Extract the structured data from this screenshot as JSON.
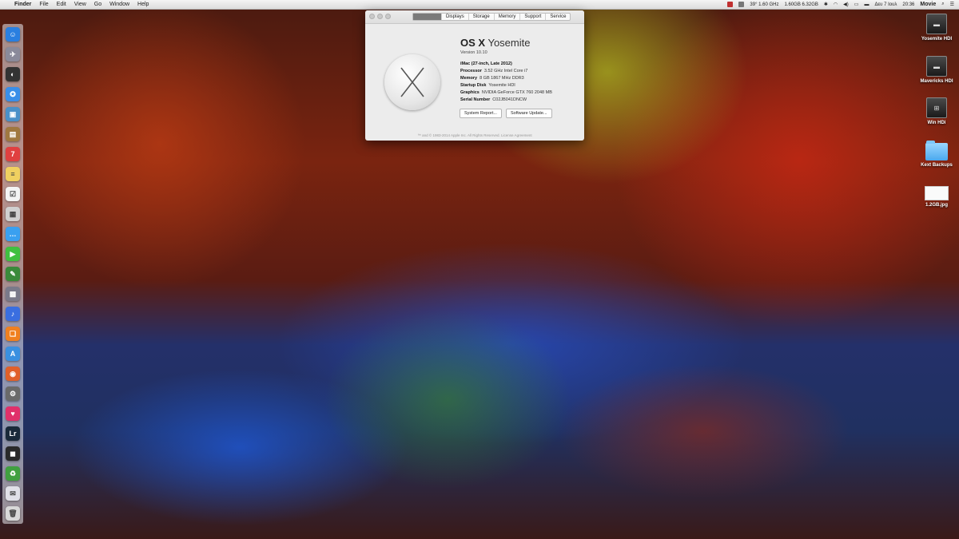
{
  "menubar": {
    "apple_glyph": "",
    "menus": [
      "Finder",
      "File",
      "Edit",
      "View",
      "Go",
      "Window",
      "Help"
    ],
    "status": {
      "temp_cpu": "39° 1.60 GHz",
      "memory": "1.60GB 6.32GB",
      "locale": "Δευ 7 Ιουλ",
      "time": "20:36",
      "app": "Movie"
    }
  },
  "dock": {
    "icons": [
      {
        "name": "finder-icon",
        "glyph": "☺",
        "color": "#2a7fe0"
      },
      {
        "name": "launchpad-icon",
        "glyph": "✈",
        "color": "#8a8a9a"
      },
      {
        "name": "dashboard-icon",
        "glyph": "◐",
        "color": "#333333"
      },
      {
        "name": "safari-icon",
        "glyph": "✪",
        "color": "#3a8ee8"
      },
      {
        "name": "preview-icon",
        "glyph": "▣",
        "color": "#4a90c8"
      },
      {
        "name": "contacts-icon",
        "glyph": "▤",
        "color": "#a07840"
      },
      {
        "name": "calendar-icon",
        "glyph": "7",
        "color": "#e04040"
      },
      {
        "name": "notes-icon",
        "glyph": "≡",
        "color": "#f0d060"
      },
      {
        "name": "reminders-icon",
        "glyph": "☑",
        "color": "#f4f4f4"
      },
      {
        "name": "photo-booth-icon",
        "glyph": "▦",
        "color": "#d0d0d0"
      },
      {
        "name": "messages-icon",
        "glyph": "…",
        "color": "#3aa0f0"
      },
      {
        "name": "facetime-icon",
        "glyph": "▶",
        "color": "#40c040"
      },
      {
        "name": "evernote-icon",
        "glyph": "✎",
        "color": "#3a8a3a"
      },
      {
        "name": "photos-icon",
        "glyph": "▩",
        "color": "#7a7a8a"
      },
      {
        "name": "itunes-icon",
        "glyph": "♪",
        "color": "#3a6ee0"
      },
      {
        "name": "ibooks-icon",
        "glyph": "❏",
        "color": "#f08020"
      },
      {
        "name": "app-store-icon",
        "glyph": "A",
        "color": "#3a90e0"
      },
      {
        "name": "firefox-icon",
        "glyph": "◉",
        "color": "#e0602a"
      },
      {
        "name": "system-preferences-icon",
        "glyph": "⚙",
        "color": "#6a6a6a"
      },
      {
        "name": "heart-app-icon",
        "glyph": "♥",
        "color": "#e0306a"
      },
      {
        "name": "lightroom-icon",
        "glyph": "Lr",
        "color": "#1a2a3a"
      },
      {
        "name": "camera-app-icon",
        "glyph": "◼",
        "color": "#2a2a2a"
      },
      {
        "name": "recycle-app-icon",
        "glyph": "♻",
        "color": "#40a040"
      },
      {
        "name": "chat-app-icon",
        "glyph": "✉",
        "color": "#e0e0e8"
      },
      {
        "name": "trash-icon",
        "glyph": "🗑",
        "color": "#d8d8d8"
      }
    ]
  },
  "about_window": {
    "tabs": [
      "Overview",
      "Displays",
      "Storage",
      "Memory",
      "Support",
      "Service"
    ],
    "title_bold": "OS X",
    "title_light": "Yosemite",
    "version": "Version 10.10",
    "specs": [
      {
        "label": "iMac (27-inch, Late 2012)",
        "value": ""
      },
      {
        "label": "Processor",
        "value": "3.52 GHz Intel Core i7"
      },
      {
        "label": "Memory",
        "value": "8 GB 1867 MHz DDR3"
      },
      {
        "label": "Startup Disk",
        "value": "Yosemite HDI"
      },
      {
        "label": "Graphics",
        "value": "NVIDIA GeForce GTX 760 2048 MB"
      },
      {
        "label": "Serial Number",
        "value": "C02JB041DNCW"
      }
    ],
    "system_report_label": "System Report...",
    "software_update_label": "Software Update...",
    "copyright": "™ and © 1983-2014 Apple Inc. All Rights Reserved. License Agreement"
  },
  "desktop_items": [
    {
      "label": "Yosemite HDI",
      "kind": "drive"
    },
    {
      "label": "Mavericks HDI",
      "kind": "drive"
    },
    {
      "label": "Win HDi",
      "kind": "drive"
    },
    {
      "label": "Kext Backups",
      "kind": "folder"
    },
    {
      "label": "1.2GB.jpg",
      "kind": "image"
    }
  ]
}
